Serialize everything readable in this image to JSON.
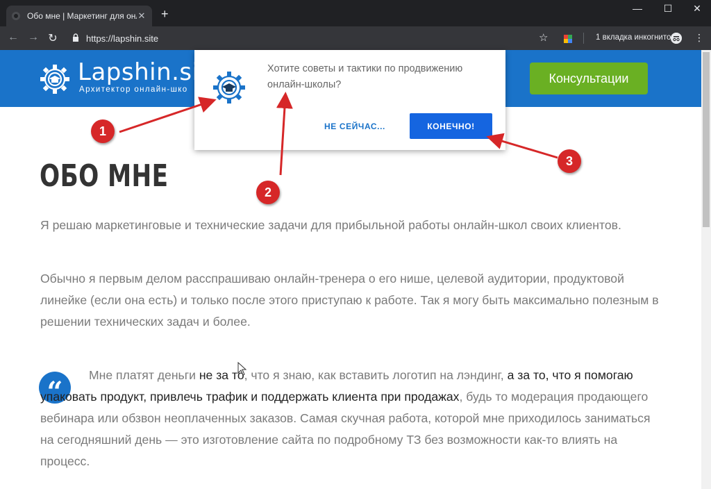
{
  "browser": {
    "tab_title": "Обо мне | Маркетинг для онлайн",
    "tab_close": "✕",
    "new_tab": "+",
    "url": "https://lapshin.site",
    "incognito_label": "1 вкладка инкогнито",
    "controls": {
      "minimize": "—",
      "maximize": "☐",
      "close": "✕"
    },
    "icons": {
      "back": "←",
      "forward": "→",
      "reload": "↻",
      "lock": "🔒",
      "star": "☆",
      "menu": "⋮",
      "incognito": "👓"
    }
  },
  "site": {
    "logo_text": "Lapshin.sit",
    "logo_subtitle": "Архитектор онлайн-шко",
    "consult_button": "Консультации",
    "brand_color": "#1a73c9",
    "accent_color": "#6ab023"
  },
  "popup": {
    "message": "Хотите советы и тактики по продвижению онлайн-школы?",
    "later_button": "НЕ СЕЙЧАС...",
    "ok_button": "КОНЕЧНО!"
  },
  "content": {
    "title": "ОБО МНЕ",
    "para1": "Я решаю маркетинговые и технические задачи для прибыльной работы онлайн-школ своих клиентов.",
    "para2": "Обычно я первым делом расспрашиваю онлайн-тренера о его нише, целевой аудитории, продуктовой линейке (если она есть) и только после этого приступаю к работе. Так я могу быть максимально полезным в решении технических задач и более.",
    "quote_mark": "“",
    "quote_parts": [
      "Мне платят деньги ",
      "не за то",
      ", что я знаю, как вставить логотип на лэндинг, ",
      "а за то, что я помогаю упаковать продукт, привлечь трафик и поддержать клиента при продажах",
      ", будь то модерация продающего вебинара или обзвон неоплаченных заказов. Самая скучная работа, которой мне приходилось заниматься на сегодняшний день — это изготовление сайта по подробному ТЗ без возможности как-то влиять на процесс."
    ]
  },
  "annotations": {
    "badges": [
      "1",
      "2",
      "3"
    ],
    "color": "#d62728"
  }
}
